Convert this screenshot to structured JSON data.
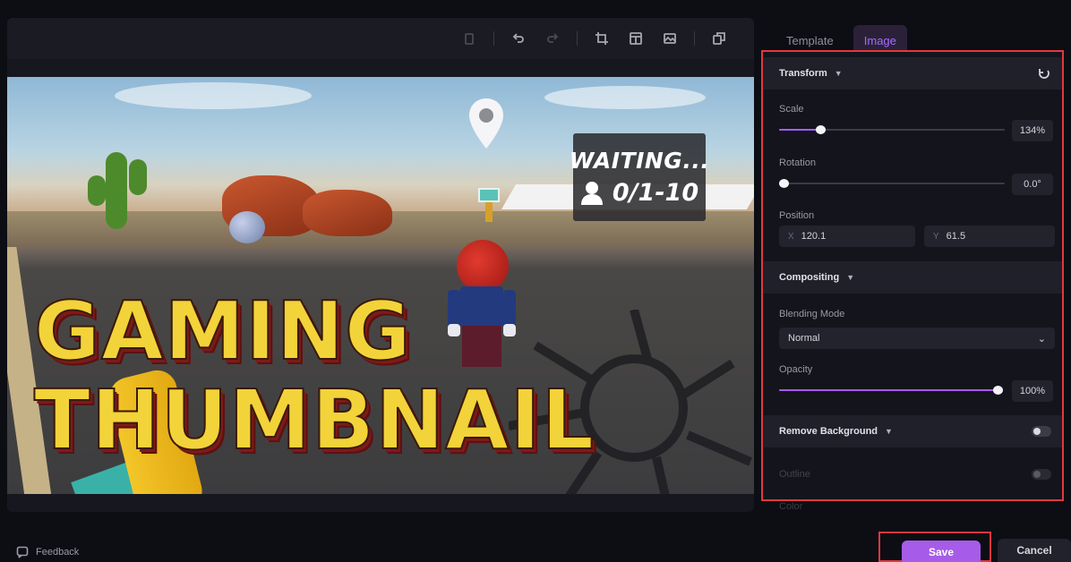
{
  "toolbar": {
    "icons": [
      "delete-icon",
      "undo-icon",
      "redo-icon",
      "crop-icon",
      "layout-icon",
      "image-icon",
      "replace-icon"
    ]
  },
  "canvas": {
    "title_line1": "GAMING",
    "title_line2": "THUMBNAIL",
    "overlay_status": "WAITING...",
    "overlay_players": "0/1-10"
  },
  "panel": {
    "tabs": [
      {
        "label": "Template"
      },
      {
        "label": "Image"
      }
    ],
    "transform": {
      "heading": "Transform",
      "scale_label": "Scale",
      "scale_value": "134%",
      "scale_level": 0.17,
      "rotation_label": "Rotation",
      "rotation_value": "0.0°",
      "rotation_level": 0.0,
      "position_label": "Position",
      "pos_x_axis": "X",
      "pos_x": "120.1",
      "pos_y_axis": "Y",
      "pos_y": "61.5"
    },
    "compositing": {
      "heading": "Compositing",
      "blend_label": "Blending Mode",
      "blend_value": "Normal",
      "opacity_label": "Opacity",
      "opacity_value": "100%",
      "opacity_level": 1.0
    },
    "remove_bg": {
      "heading": "Remove Background",
      "outline_label": "Outline"
    },
    "below_label": "Color"
  },
  "footer": {
    "feedback": "Feedback",
    "save": "Save",
    "cancel": "Cancel"
  },
  "colors": {
    "accent": "#a65ce8",
    "highlight_border": "#e0393e",
    "title_yellow": "#f3d33a"
  }
}
